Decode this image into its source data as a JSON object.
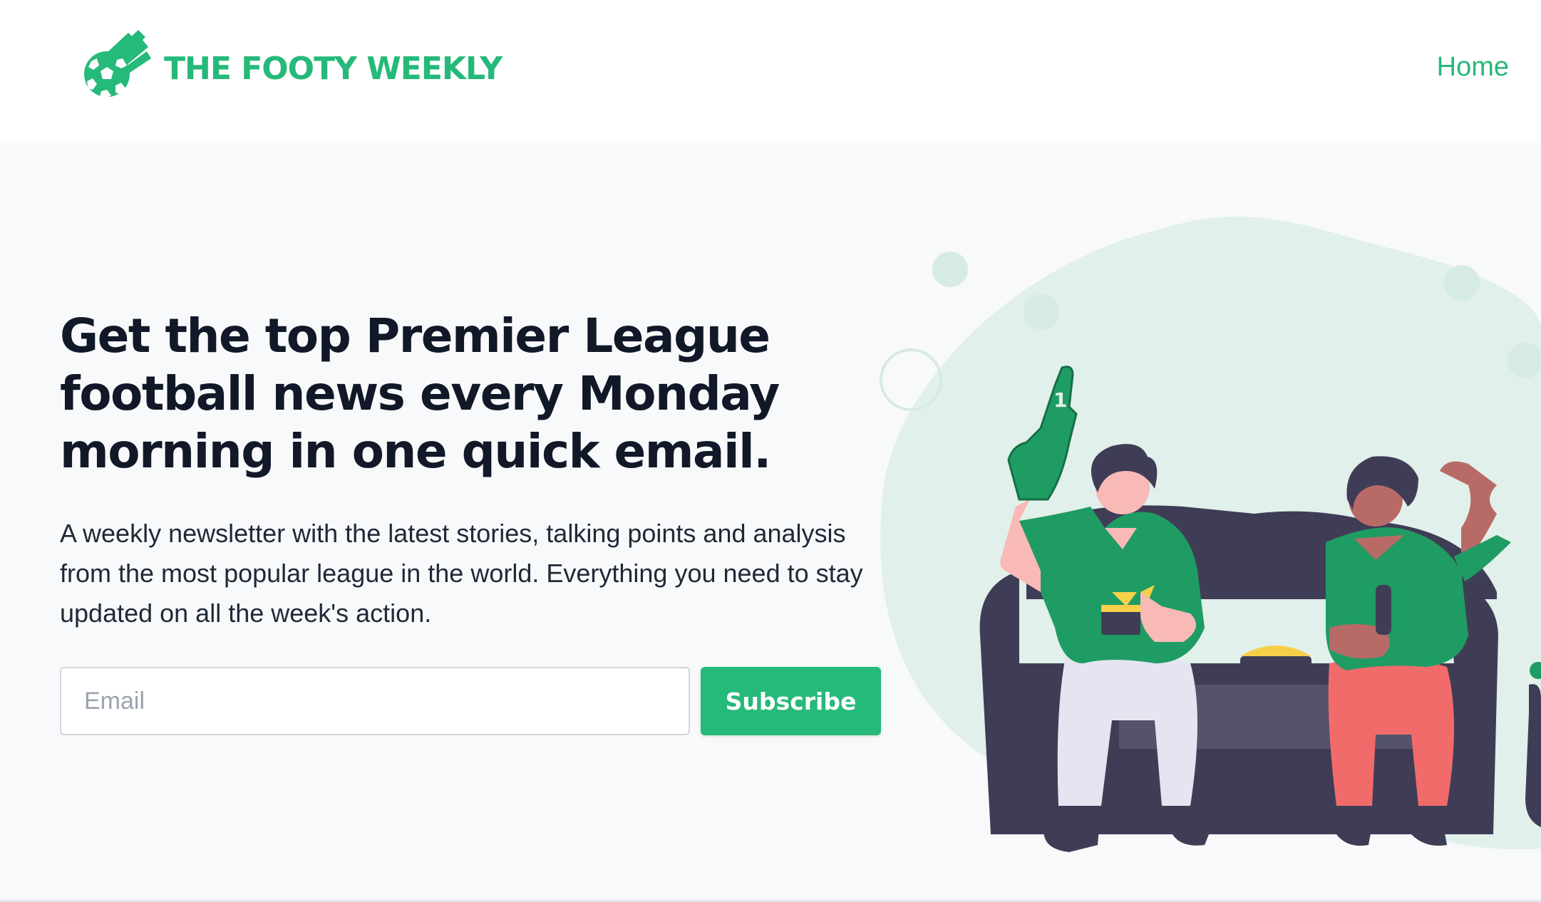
{
  "brand": {
    "name": "THE FOOTY WEEKLY",
    "color": "#25b97a"
  },
  "nav": {
    "home_label": "Home"
  },
  "hero": {
    "headline": "Get the top Premier League football news every Monday morning in one quick email.",
    "description": "A weekly newsletter with the latest stories, talking points and analysis from the most popular league in the world. Everything you need to stay updated on all the week's action.",
    "email_placeholder": "Email",
    "email_value": "",
    "subscribe_label": "Subscribe",
    "illustration_icon": "football-fans-on-couch-illustration",
    "foam_finger_number": "1"
  },
  "colors": {
    "accent": "#25b97a",
    "heading": "#111827",
    "body_text": "#1f2937",
    "hero_background": "#f8f9fb",
    "blob": "#e1f0ea",
    "couch": "#3f3d56",
    "jersey": "#1f9c63",
    "red_pants": "#f26b6b"
  }
}
